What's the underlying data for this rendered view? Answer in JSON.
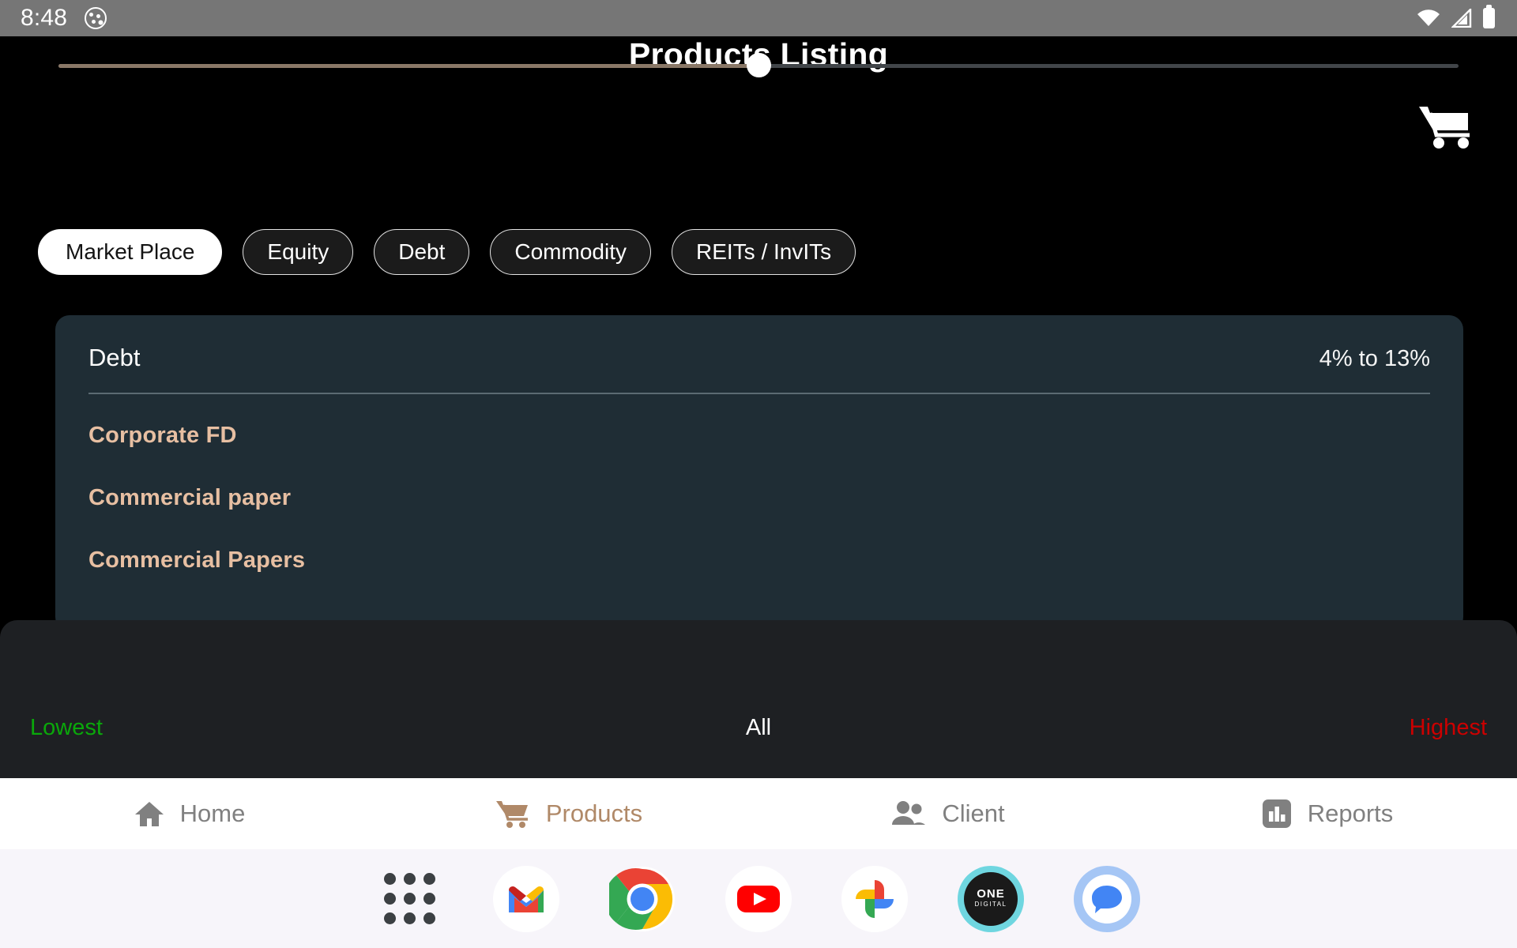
{
  "status_bar": {
    "time": "8:48",
    "notification_icon": "cookie-icon",
    "wifi_icon": "wifi-icon",
    "signal_icon": "cellular-signal-icon",
    "battery_icon": "battery-full-icon"
  },
  "header": {
    "title": "Products Listing",
    "cart_icon": "shopping-cart-icon"
  },
  "filter_chips": [
    {
      "label": "Market Place",
      "active": true
    },
    {
      "label": "Equity",
      "active": false
    },
    {
      "label": "Debt",
      "active": false
    },
    {
      "label": "Commodity",
      "active": false
    },
    {
      "label": "REITs / InvITs",
      "active": false
    }
  ],
  "product_card": {
    "category": "Debt",
    "return_range": "4% to 13%",
    "items": [
      "Corporate FD",
      "Commercial paper",
      "Commercial Papers"
    ]
  },
  "slider": {
    "value_label": "All",
    "min_label": "Lowest",
    "max_label": "Highest",
    "position_percent": 50,
    "min_color": "#0aa80a",
    "max_color": "#cc0000",
    "fill_color": "#8a7867"
  },
  "bottom_nav": [
    {
      "label": "Home",
      "icon": "home-icon",
      "active": false
    },
    {
      "label": "Products",
      "icon": "cart-icon",
      "active": true
    },
    {
      "label": "Client",
      "icon": "people-icon",
      "active": false
    },
    {
      "label": "Reports",
      "icon": "bar-chart-icon",
      "active": false
    }
  ],
  "dock": [
    {
      "name": "app-drawer-icon",
      "label": ""
    },
    {
      "name": "gmail-icon",
      "label": ""
    },
    {
      "name": "chrome-icon",
      "label": ""
    },
    {
      "name": "youtube-icon",
      "label": ""
    },
    {
      "name": "google-photos-icon",
      "label": ""
    },
    {
      "name": "one-digital-icon",
      "label_line1": "ONE",
      "label_line2": "DIGITAL"
    },
    {
      "name": "google-messages-icon",
      "label": ""
    }
  ],
  "colors": {
    "accent_tan": "#e7bfa2",
    "nav_active": "#b08968",
    "card_bg": "#1f2d35",
    "sheet_bg": "#1e2023"
  }
}
